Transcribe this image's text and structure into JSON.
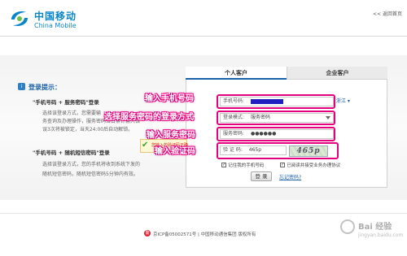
{
  "header": {
    "brand_cn": "中国移动",
    "brand_en": "China Mobile",
    "back_home": "<< 返回首页"
  },
  "tips": {
    "title": "登录提示：",
    "items": [
      {
        "head": "\"手机号码 + 服务密码\"登录",
        "lines": [
          "选择该登录方式，您需要输",
          "务查询及办理操作，服务密码当日累计输入错",
          "误3次将被锁定，当天24:00后自动解锁。"
        ]
      },
      {
        "head": "\"手机号码 + 随机短信密码\"登录",
        "lines": [
          "选择该登录方式，您的手机将收到系统下发的",
          "随机短信密码，随机短信密码5分钟内有效。"
        ]
      }
    ]
  },
  "tabs": {
    "personal": "个人客户",
    "enterprise": "企业客户"
  },
  "form": {
    "phone_label": "手机号码:",
    "region": "浙江 ▾",
    "login_mode_label": "登录模式:",
    "login_mode_value": "服务密码",
    "password_label": "服务密码:",
    "password_value": "●●●●●●",
    "captcha_label": "验 证 码:",
    "captcha_value": "465p",
    "captcha_image_text": "465p",
    "remember_label": "记住我的手机号码",
    "agree_label": "已阅读并接受业务办理协议",
    "login_button": "登 录",
    "forgot_link": "忘记密码?"
  },
  "error_tip": {
    "text": "您输入的验证码正确"
  },
  "annotations": {
    "phone": "输入手机号码",
    "mode": "选择服务密码的登录方式",
    "password": "输入服务密码",
    "captcha": "输入验证码"
  },
  "footer": {
    "text": "京ICP备05002571号 | 中国移动通信集团 版权所有"
  },
  "watermark": {
    "text": "Bai 经验",
    "url": "jingyan.baidu.com"
  },
  "colors": {
    "brand_blue": "#0a86c8",
    "highlight_magenta": "#e5007e"
  }
}
